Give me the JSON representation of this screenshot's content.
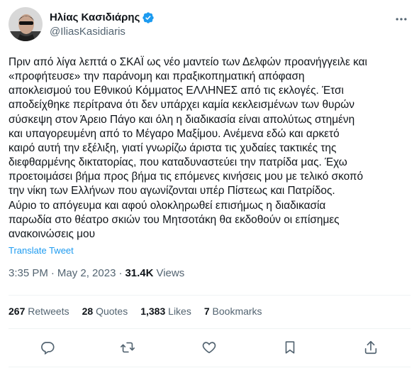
{
  "author": {
    "display_name": "Ηλίας Κασιδιάρης",
    "handle": "@IliasKasidiaris",
    "verified": true
  },
  "tweet": {
    "text": "Πριν από λίγα λεπτά ο ΣΚΑΪ ως νέο μαντείο των Δελφών προανήγγειλε και\n«προφήτευσε» την παράνομη και πραξικοπηματική απόφαση\nαποκλεισμού του Εθνικού Κόμματος ΕΛΛΗΝΕΣ από τις εκλογές. Έτσι\nαποδείχθηκε περίτρανα ότι δεν υπάρχει καμία κεκλεισμένων των θυρών\nσύσκεψη στον Άρειο Πάγο και όλη η διαδικασία είναι απολύτως στημένη\nκαι υπαγορευμένη από το Μέγαρο Μαξίμου. Ανέμενα εδώ και αρκετό\nκαιρό αυτή την εξέλιξη, γιατί γνωρίζω άριστα τις χυδαίες τακτικές της\nδιεφθαρμένης δικτατορίας, που καταδυναστεύει την πατρίδα μας. Έχω\nπροετοιμάσει βήμα προς βήμα τις επόμενες κινήσεις μου με τελικό σκοπό\nτην νίκη των Ελλήνων που αγωνίζονται υπέρ Πίστεως και Πατρίδος.\nΑύριο το απόγευμα και αφού ολοκληρωθεί επισήμως η διαδικασία\nπαρωδία στο θέατρο σκιών του Μητσοτάκη θα εκδοθούν οι επίσημες\nανακοινώσεις μου",
    "translate_label": "Translate Tweet",
    "time": "3:35 PM",
    "separator": "·",
    "date": "May 2, 2023",
    "views_count": "31.4K",
    "views_label": "Views"
  },
  "stats": {
    "retweets_count": "267",
    "retweets_label": "Retweets",
    "quotes_count": "28",
    "quotes_label": "Quotes",
    "likes_count": "1,383",
    "likes_label": "Likes",
    "bookmarks_count": "7",
    "bookmarks_label": "Bookmarks"
  },
  "actions": [
    "reply-icon",
    "retweet-icon",
    "like-icon",
    "bookmark-icon",
    "share-icon"
  ],
  "colors": {
    "text": "#0f1419",
    "secondary": "#536471",
    "link": "#1d9bf0",
    "divider": "#eff3f4"
  }
}
